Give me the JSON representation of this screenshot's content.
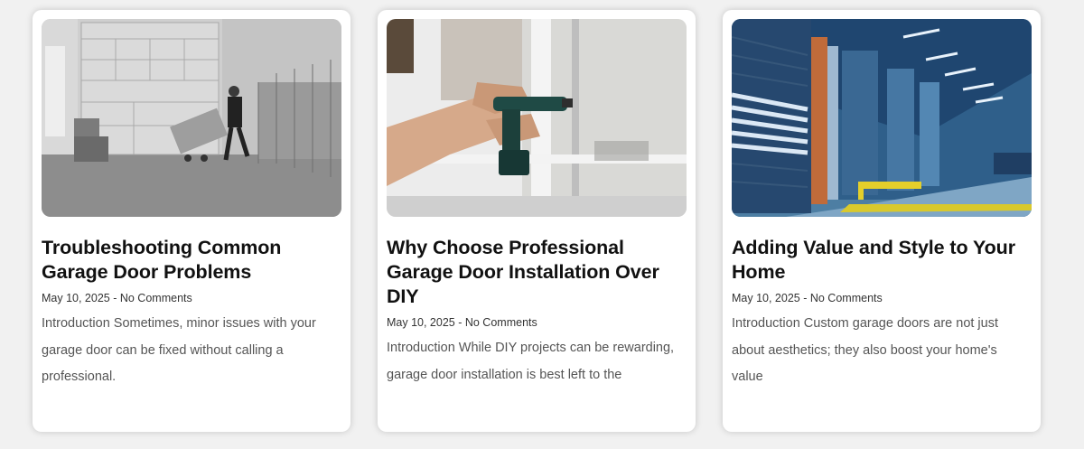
{
  "posts": [
    {
      "image_icon": "garage-delivery-photo",
      "title": "Troubleshooting Common Garage Door Problems",
      "date": "May 10, 2025",
      "separator": " - ",
      "comments": "No Comments",
      "excerpt": "Introduction Sometimes, minor issues with your garage door can be fixed without calling a professional."
    },
    {
      "image_icon": "drill-installation-photo",
      "title": "Why Choose Professional Garage Door Installation Over DIY",
      "date": "May 10, 2025",
      "separator": " - ",
      "comments": "No Comments",
      "excerpt": "Introduction While DIY projects can be rewarding, garage door installation is best left to the"
    },
    {
      "image_icon": "warehouse-doors-photo",
      "title": "Adding Value and Style to Your Home",
      "date": "May 10, 2025",
      "separator": " - ",
      "comments": "No Comments",
      "excerpt": "Introduction Custom garage doors are not just about aesthetics; they also boost your home's value"
    }
  ]
}
